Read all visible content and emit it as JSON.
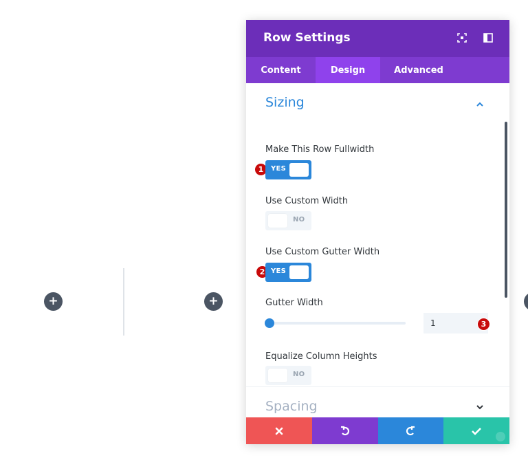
{
  "modal": {
    "title": "Row Settings",
    "header_icons": [
      "focus-icon",
      "split-view-icon"
    ],
    "tabs": [
      {
        "label": "Content",
        "active": false
      },
      {
        "label": "Design",
        "active": true
      },
      {
        "label": "Advanced",
        "active": false
      }
    ]
  },
  "sections": {
    "sizing": {
      "title": "Sizing",
      "expanded": true
    },
    "spacing": {
      "title": "Spacing",
      "expanded": false
    }
  },
  "fields": {
    "fullwidth": {
      "label": "Make This Row Fullwidth",
      "value": "YES",
      "on": true,
      "marker": "1"
    },
    "custom_width": {
      "label": "Use Custom Width",
      "value": "NO",
      "on": false
    },
    "custom_gutter": {
      "label": "Use Custom Gutter Width",
      "value": "YES",
      "on": true,
      "marker": "2"
    },
    "gutter_width": {
      "label": "Gutter Width",
      "value": "1",
      "slider_fraction": 0.0,
      "marker": "3"
    },
    "equalize": {
      "label": "Equalize Column Heights",
      "value": "NO",
      "on": false
    }
  },
  "footer": {
    "buttons": [
      "close-icon",
      "undo-icon",
      "redo-icon",
      "checkmark-icon"
    ]
  },
  "colors": {
    "header": "#6c2eb9",
    "tabs": "#7e3bd0",
    "active_tab": "#8f42ec",
    "accent": "#2b87da",
    "cancel": "#ef5555",
    "undo": "#7e3bd0",
    "redo": "#2b87da",
    "save": "#29c4a9",
    "marker": "#c80a0a"
  }
}
